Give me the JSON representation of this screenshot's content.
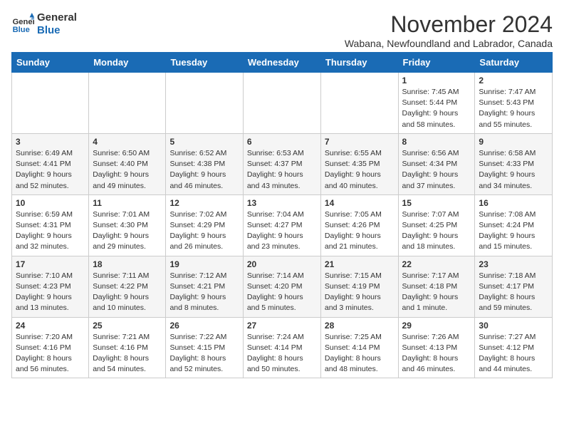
{
  "logo": {
    "line1": "General",
    "line2": "Blue"
  },
  "title": "November 2024",
  "location": "Wabana, Newfoundland and Labrador, Canada",
  "days_of_week": [
    "Sunday",
    "Monday",
    "Tuesday",
    "Wednesday",
    "Thursday",
    "Friday",
    "Saturday"
  ],
  "weeks": [
    [
      {
        "day": "",
        "info": ""
      },
      {
        "day": "",
        "info": ""
      },
      {
        "day": "",
        "info": ""
      },
      {
        "day": "",
        "info": ""
      },
      {
        "day": "",
        "info": ""
      },
      {
        "day": "1",
        "info": "Sunrise: 7:45 AM\nSunset: 5:44 PM\nDaylight: 9 hours and 58 minutes."
      },
      {
        "day": "2",
        "info": "Sunrise: 7:47 AM\nSunset: 5:43 PM\nDaylight: 9 hours and 55 minutes."
      }
    ],
    [
      {
        "day": "3",
        "info": "Sunrise: 6:49 AM\nSunset: 4:41 PM\nDaylight: 9 hours and 52 minutes."
      },
      {
        "day": "4",
        "info": "Sunrise: 6:50 AM\nSunset: 4:40 PM\nDaylight: 9 hours and 49 minutes."
      },
      {
        "day": "5",
        "info": "Sunrise: 6:52 AM\nSunset: 4:38 PM\nDaylight: 9 hours and 46 minutes."
      },
      {
        "day": "6",
        "info": "Sunrise: 6:53 AM\nSunset: 4:37 PM\nDaylight: 9 hours and 43 minutes."
      },
      {
        "day": "7",
        "info": "Sunrise: 6:55 AM\nSunset: 4:35 PM\nDaylight: 9 hours and 40 minutes."
      },
      {
        "day": "8",
        "info": "Sunrise: 6:56 AM\nSunset: 4:34 PM\nDaylight: 9 hours and 37 minutes."
      },
      {
        "day": "9",
        "info": "Sunrise: 6:58 AM\nSunset: 4:33 PM\nDaylight: 9 hours and 34 minutes."
      }
    ],
    [
      {
        "day": "10",
        "info": "Sunrise: 6:59 AM\nSunset: 4:31 PM\nDaylight: 9 hours and 32 minutes."
      },
      {
        "day": "11",
        "info": "Sunrise: 7:01 AM\nSunset: 4:30 PM\nDaylight: 9 hours and 29 minutes."
      },
      {
        "day": "12",
        "info": "Sunrise: 7:02 AM\nSunset: 4:29 PM\nDaylight: 9 hours and 26 minutes."
      },
      {
        "day": "13",
        "info": "Sunrise: 7:04 AM\nSunset: 4:27 PM\nDaylight: 9 hours and 23 minutes."
      },
      {
        "day": "14",
        "info": "Sunrise: 7:05 AM\nSunset: 4:26 PM\nDaylight: 9 hours and 21 minutes."
      },
      {
        "day": "15",
        "info": "Sunrise: 7:07 AM\nSunset: 4:25 PM\nDaylight: 9 hours and 18 minutes."
      },
      {
        "day": "16",
        "info": "Sunrise: 7:08 AM\nSunset: 4:24 PM\nDaylight: 9 hours and 15 minutes."
      }
    ],
    [
      {
        "day": "17",
        "info": "Sunrise: 7:10 AM\nSunset: 4:23 PM\nDaylight: 9 hours and 13 minutes."
      },
      {
        "day": "18",
        "info": "Sunrise: 7:11 AM\nSunset: 4:22 PM\nDaylight: 9 hours and 10 minutes."
      },
      {
        "day": "19",
        "info": "Sunrise: 7:12 AM\nSunset: 4:21 PM\nDaylight: 9 hours and 8 minutes."
      },
      {
        "day": "20",
        "info": "Sunrise: 7:14 AM\nSunset: 4:20 PM\nDaylight: 9 hours and 5 minutes."
      },
      {
        "day": "21",
        "info": "Sunrise: 7:15 AM\nSunset: 4:19 PM\nDaylight: 9 hours and 3 minutes."
      },
      {
        "day": "22",
        "info": "Sunrise: 7:17 AM\nSunset: 4:18 PM\nDaylight: 9 hours and 1 minute."
      },
      {
        "day": "23",
        "info": "Sunrise: 7:18 AM\nSunset: 4:17 PM\nDaylight: 8 hours and 59 minutes."
      }
    ],
    [
      {
        "day": "24",
        "info": "Sunrise: 7:20 AM\nSunset: 4:16 PM\nDaylight: 8 hours and 56 minutes."
      },
      {
        "day": "25",
        "info": "Sunrise: 7:21 AM\nSunset: 4:16 PM\nDaylight: 8 hours and 54 minutes."
      },
      {
        "day": "26",
        "info": "Sunrise: 7:22 AM\nSunset: 4:15 PM\nDaylight: 8 hours and 52 minutes."
      },
      {
        "day": "27",
        "info": "Sunrise: 7:24 AM\nSunset: 4:14 PM\nDaylight: 8 hours and 50 minutes."
      },
      {
        "day": "28",
        "info": "Sunrise: 7:25 AM\nSunset: 4:14 PM\nDaylight: 8 hours and 48 minutes."
      },
      {
        "day": "29",
        "info": "Sunrise: 7:26 AM\nSunset: 4:13 PM\nDaylight: 8 hours and 46 minutes."
      },
      {
        "day": "30",
        "info": "Sunrise: 7:27 AM\nSunset: 4:12 PM\nDaylight: 8 hours and 44 minutes."
      }
    ]
  ]
}
